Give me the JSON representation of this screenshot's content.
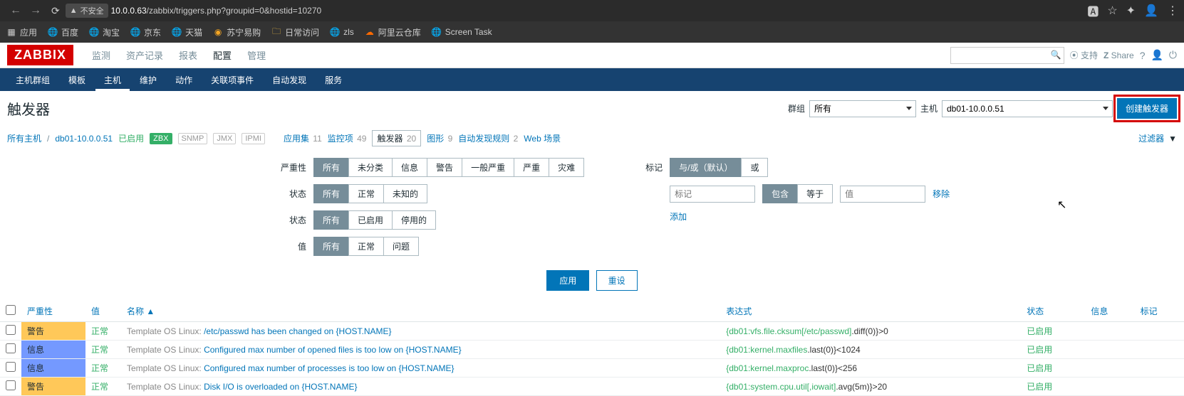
{
  "browser": {
    "insecure_label": "不安全",
    "url_host": "10.0.0.63",
    "url_path": "/zabbix/triggers.php?groupid=0&hostid=10270"
  },
  "bookmarks": {
    "apps": "应用",
    "items": [
      "百度",
      "淘宝",
      "京东",
      "天猫",
      "苏宁易购",
      "日常访问",
      "zls",
      "阿里云仓库",
      "Screen Task"
    ]
  },
  "top_nav": {
    "logo": "ZABBIX",
    "items": [
      "监测",
      "资产记录",
      "报表",
      "配置",
      "管理"
    ],
    "active": "配置",
    "support": "支持",
    "share": "Share"
  },
  "sub_nav": {
    "items": [
      "主机群组",
      "模板",
      "主机",
      "维护",
      "动作",
      "关联项事件",
      "自动发现",
      "服务"
    ],
    "active": "主机"
  },
  "page": {
    "title": "触发器",
    "group_label": "群组",
    "group_value": "所有",
    "host_label": "主机",
    "host_value": "db01-10.0.0.51",
    "create_btn": "创建触发器"
  },
  "crumb": {
    "all_hosts": "所有主机",
    "host": "db01-10.0.0.51",
    "enabled": "已启用",
    "tags": [
      "ZBX",
      "SNMP",
      "JMX",
      "IPMI"
    ],
    "items": [
      {
        "label": "应用集",
        "count": "11"
      },
      {
        "label": "监控项",
        "count": "49"
      },
      {
        "label": "触发器",
        "count": "20",
        "active": true
      },
      {
        "label": "图形",
        "count": "9"
      },
      {
        "label": "自动发现规则",
        "count": "2"
      },
      {
        "label": "Web 场景",
        "count": ""
      }
    ],
    "filter_label": "过滤器"
  },
  "filters": {
    "severity": {
      "label": "严重性",
      "options": [
        "所有",
        "未分类",
        "信息",
        "警告",
        "一般严重",
        "严重",
        "灾难"
      ],
      "selected": "所有"
    },
    "state": {
      "label": "状态",
      "options": [
        "所有",
        "正常",
        "未知的"
      ],
      "selected": "所有"
    },
    "status": {
      "label": "状态",
      "options": [
        "所有",
        "已启用",
        "停用的"
      ],
      "selected": "所有"
    },
    "value": {
      "label": "值",
      "options": [
        "所有",
        "正常",
        "问题"
      ],
      "selected": "所有"
    },
    "tags": {
      "label": "标记",
      "mode_options": [
        "与/或（默认）",
        "或"
      ],
      "mode_selected": "与/或（默认）",
      "tag_placeholder": "标记",
      "op_options": [
        "包含",
        "等于"
      ],
      "op_selected": "包含",
      "val_placeholder": "值",
      "remove": "移除",
      "add": "添加"
    },
    "apply": "应用",
    "reset": "重设"
  },
  "table": {
    "headers": {
      "severity": "严重性",
      "value": "值",
      "name": "名称",
      "expression": "表达式",
      "status": "状态",
      "info": "信息",
      "tags": "标记"
    },
    "sort_indicator": "▲",
    "rows": [
      {
        "sev_class": "sev-warning",
        "sev": "警告",
        "val": "正常",
        "name_prefix": "Template OS Linux: ",
        "name_link": "/etc/passwd has been changed on {HOST.NAME}",
        "expr_key": "{db01:vfs.file.cksum[/etc/passwd]",
        "expr_rest": ".diff(0)}>0",
        "status": "已启用"
      },
      {
        "sev_class": "sev-info",
        "sev": "信息",
        "val": "正常",
        "name_prefix": "Template OS Linux: ",
        "name_link": "Configured max number of opened files is too low on {HOST.NAME}",
        "expr_key": "{db01:kernel.maxfiles",
        "expr_rest": ".last(0)}<1024",
        "status": "已启用"
      },
      {
        "sev_class": "sev-info",
        "sev": "信息",
        "val": "正常",
        "name_prefix": "Template OS Linux: ",
        "name_link": "Configured max number of processes is too low on {HOST.NAME}",
        "expr_key": "{db01:kernel.maxproc",
        "expr_rest": ".last(0)}<256",
        "status": "已启用"
      },
      {
        "sev_class": "sev-warning",
        "sev": "警告",
        "val": "正常",
        "name_prefix": "Template OS Linux: ",
        "name_link": "Disk I/O is overloaded on {HOST.NAME}",
        "expr_key": "{db01:system.cpu.util[,iowait]",
        "expr_rest": ".avg(5m)}>20",
        "status": "已启用"
      }
    ]
  }
}
